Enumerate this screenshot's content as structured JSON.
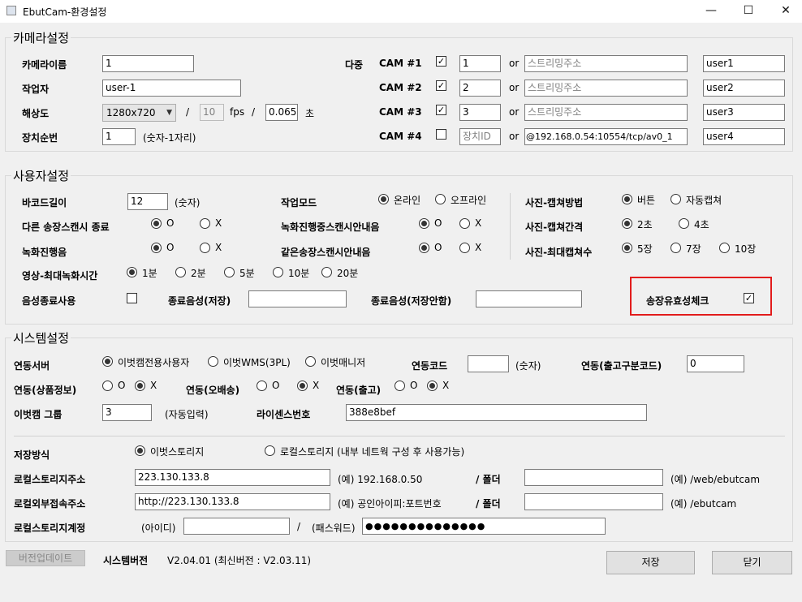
{
  "window": {
    "title": "EbutCam-환경설정",
    "minimize": "—",
    "maximize": "☐",
    "close": "✕"
  },
  "camera": {
    "legend": "카메라설정",
    "name_label": "카메라이름",
    "name_value": "1",
    "worker_label": "작업자",
    "worker_value": "user-1",
    "resolution_label": "해상도",
    "resolution_value": "1280x720",
    "slash": "/",
    "fps_value": "10",
    "fps_label": "fps",
    "sec_value": "0.065",
    "sec_label": "초",
    "device_label": "장치순번",
    "device_value": "1",
    "device_hint": "(숫자-1자리)",
    "multi_label": "다중",
    "cams": [
      {
        "label": "CAM #1",
        "checked": "✓",
        "num": "1",
        "or": "or",
        "stream": "스트리밍주소",
        "user": "user1"
      },
      {
        "label": "CAM #2",
        "checked": "✓",
        "num": "2",
        "or": "or",
        "stream": "스트리밍주소",
        "user": "user2"
      },
      {
        "label": "CAM #3",
        "checked": "✓",
        "num": "3",
        "or": "or",
        "stream": "스트리밍주소",
        "user": "user3"
      },
      {
        "label": "CAM #4",
        "checked": "",
        "num": "장치ID",
        "or": "or",
        "stream": "@192.168.0.54:10554/tcp/av0_1",
        "user": "user4"
      }
    ]
  },
  "user": {
    "legend": "사용자설정",
    "barcode_label": "바코드길이",
    "barcode_value": "12",
    "barcode_hint": "(숫자)",
    "diffscan_label": "다른 송장스캔시 종료",
    "o": "O",
    "x": "X",
    "recording_label": "녹화진행음",
    "video_label": "영상-최대녹화시간",
    "durations": [
      "1분",
      "2분",
      "5분",
      "10분",
      "20분"
    ],
    "voiceend_label": "음성종료사용",
    "voicesave_label": "종료음성(저장)",
    "voicenosave_label": "종료음성(저장안함)",
    "workmode_label": "작업모드",
    "online": "온라인",
    "offline": "오프라인",
    "recscan_label": "녹화진행중스캔시안내음",
    "samescan_label": "같은송장스캔시안내음",
    "capmethod_label": "사진-캡쳐방법",
    "button_opt": "버튼",
    "auto_opt": "자동캡쳐",
    "capinterval_label": "사진-캡쳐간격",
    "sec2": "2초",
    "sec4": "4초",
    "capmax_label": "사진-최대캡쳐수",
    "c5": "5장",
    "c7": "7장",
    "c10": "10장",
    "validity_label": "송장유효성체크",
    "validity_check": "✓"
  },
  "system": {
    "legend": "시스템설정",
    "server_label": "연동서버",
    "srv1": "이벗캠전용사용자",
    "srv2": "이벗WMS(3PL)",
    "srv3": "이벗매니저",
    "code_label": "연동코드",
    "code_hint": "(숫자)",
    "shipcode_label": "연동(출고구분코드)",
    "shipcode_value": "0",
    "product_label": "연동(상품정보)",
    "o": "O",
    "x": "X",
    "delivery_label": "연동(오배송)",
    "outbound_label": "연동(출고)",
    "group_label": "이벗캠 그룹",
    "group_value": "3",
    "group_hint": "(자동입력)",
    "license_label": "라이센스번호",
    "license_value": "388e8bef",
    "storage_label": "저장방식",
    "st_ebut": "이벗스토리지",
    "st_local": "로컬스토리지 (내부 네트웍 구성 후 사용가능)",
    "localaddr_label": "로컬스토리지주소",
    "localaddr_value": "223.130.133.8",
    "localaddr_ex": "(예) 192.168.0.50",
    "folder_label": "/ 폴더",
    "folder1_ex": "(예) /web/ebutcam",
    "extaddr_label": "로컬외부접속주소",
    "extaddr_value": "http://223.130.133.8",
    "extaddr_ex": "(예) 공인아이피:포트번호",
    "folder2_ex": "(예) /ebutcam",
    "account_label": "로컬스토리지계정",
    "id_label": "(아이디)",
    "slash": "/",
    "pw_label": "(패스워드)",
    "pw_value": "●●●●●●●●●●●●●●"
  },
  "footer": {
    "update_btn": "버전업데이트",
    "version_label": "시스템버전",
    "version_value": "V2.04.01 (최신버전 : V2.03.11)",
    "save_btn": "저장",
    "close_btn": "닫기"
  }
}
